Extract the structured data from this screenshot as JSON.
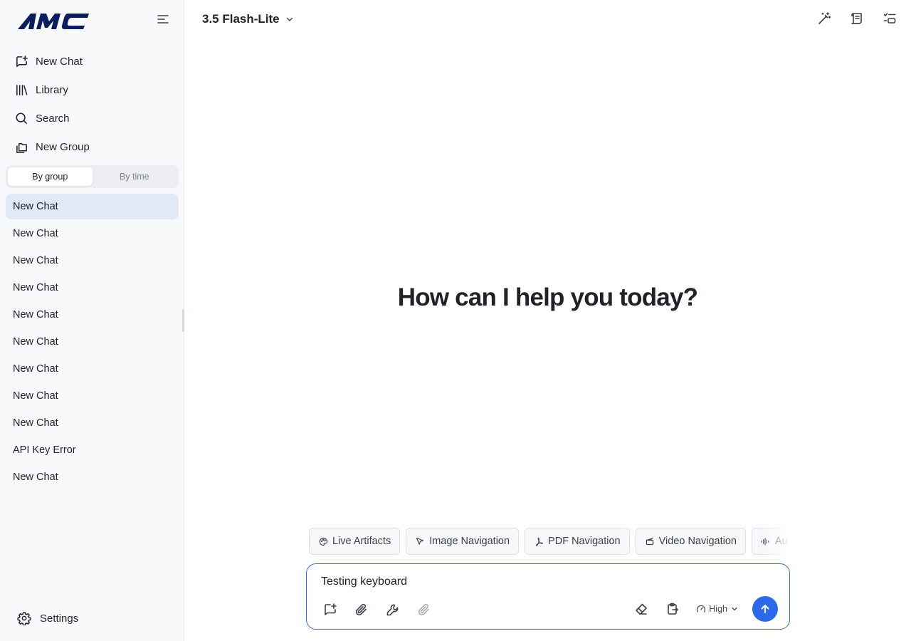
{
  "app": {
    "logo_text": "AMC",
    "brand_color": "#0b1d5c",
    "accent_color": "#2a6ae8"
  },
  "sidebar": {
    "nav": [
      {
        "label": "New Chat",
        "icon": "new-chat-icon"
      },
      {
        "label": "Library",
        "icon": "library-icon"
      },
      {
        "label": "Search",
        "icon": "search-icon"
      },
      {
        "label": "New Group",
        "icon": "new-group-icon"
      }
    ],
    "segment": {
      "by_group": "By group",
      "by_time": "By time",
      "selected": "By group"
    },
    "chats": [
      {
        "label": "New Chat"
      },
      {
        "label": "New Chat"
      },
      {
        "label": "New Chat"
      },
      {
        "label": "New Chat"
      },
      {
        "label": "New Chat"
      },
      {
        "label": "New Chat"
      },
      {
        "label": "New Chat"
      },
      {
        "label": "New Chat"
      },
      {
        "label": "New Chat"
      },
      {
        "label": "API Key Error"
      },
      {
        "label": "New Chat"
      }
    ],
    "settings_label": "Settings"
  },
  "header": {
    "model": "3.5 Flash-Lite",
    "icons": [
      "magic-wand-icon",
      "scroll-icon",
      "toggle-list-icon"
    ]
  },
  "main": {
    "welcome": "How can I help you today?"
  },
  "chips": [
    {
      "label": "Live Artifacts",
      "icon": "palette-icon"
    },
    {
      "label": "Image Navigation",
      "icon": "cursor-icon"
    },
    {
      "label": "PDF Navigation",
      "icon": "pdf-icon"
    },
    {
      "label": "Video Navigation",
      "icon": "clapperboard-icon"
    },
    {
      "label": "Au",
      "icon": "audio-wave-icon"
    }
  ],
  "composer": {
    "value": "Testing keyboard",
    "effort_label": "High"
  }
}
